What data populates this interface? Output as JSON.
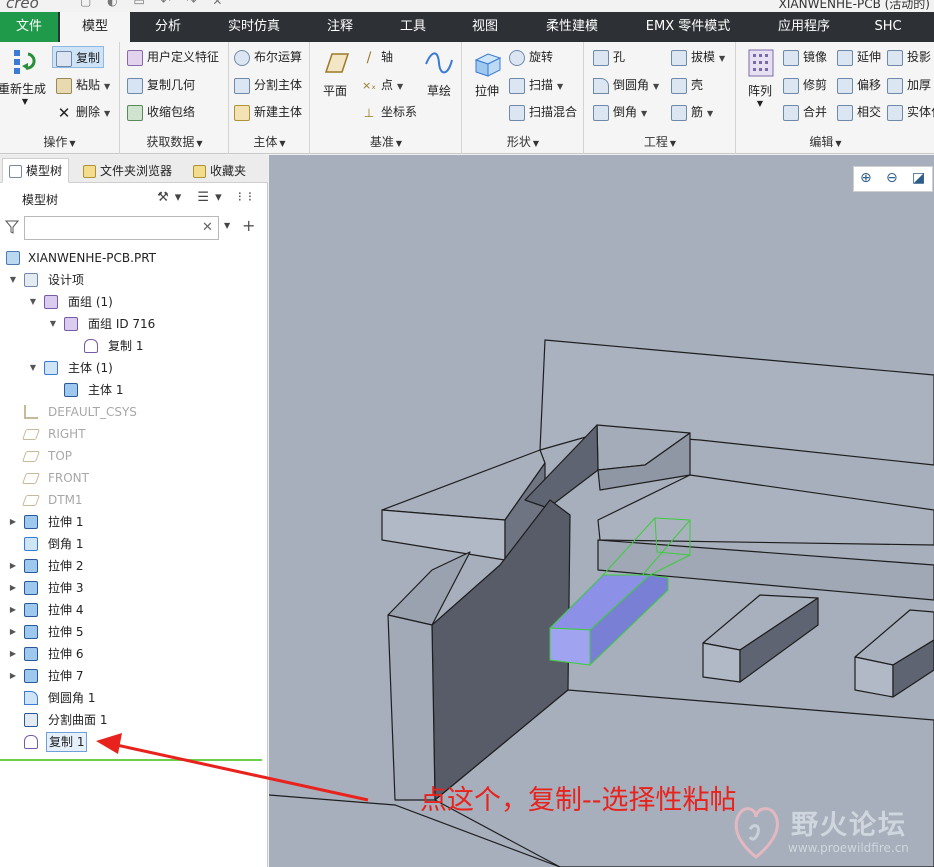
{
  "window": {
    "app_logo": "creo",
    "quick_access_icons": [
      "new-icon",
      "open-icon",
      "save-icon",
      "undo-icon",
      "redo-icon",
      "close-icon"
    ],
    "title": "XIANWENHE-PCB (活动的)"
  },
  "menu_tabs": [
    {
      "label": "文件"
    },
    {
      "label": "模型"
    },
    {
      "label": "分析"
    },
    {
      "label": "实时仿真"
    },
    {
      "label": "注释"
    },
    {
      "label": "工具"
    },
    {
      "label": "视图"
    },
    {
      "label": "柔性建模"
    },
    {
      "label": "EMX 零件模式"
    },
    {
      "label": "应用程序"
    },
    {
      "label": "SHC"
    }
  ],
  "ribbon": {
    "operations": {
      "label": "操作",
      "regenerate": "重新生成",
      "copy": "复制",
      "paste": "粘贴",
      "delete": "删除"
    },
    "get_data": {
      "label": "获取数据",
      "udf": "用户定义特征",
      "copy_geom": "复制几何",
      "shrinkwrap": "收缩包络"
    },
    "body": {
      "label": "主体",
      "boolean": "布尔运算",
      "split": "分割主体",
      "new": "新建主体"
    },
    "datum": {
      "label": "基准",
      "plane": "平面",
      "axis": "轴",
      "point": "点",
      "csys": "坐标系",
      "sketch": "草绘"
    },
    "shapes": {
      "label": "形状",
      "extrude": "拉伸",
      "revolve": "旋转",
      "sweep": "扫描",
      "swept_blend": "扫描混合"
    },
    "engineering": {
      "label": "工程",
      "hole": "孔",
      "round": "倒圆角",
      "chamfer": "倒角",
      "draft": "拔模",
      "shell": "壳",
      "rib": "筋"
    },
    "editing": {
      "label": "编辑",
      "pattern": "阵列",
      "mirror": "镜像",
      "trim": "修剪",
      "merge": "合并",
      "extend": "延伸",
      "offset": "偏移",
      "intersect": "相交",
      "project": "投影",
      "thicken": "加厚",
      "solidify": "实体化"
    }
  },
  "panel_tabs": [
    "模型树",
    "文件夹浏览器",
    "收藏夹"
  ],
  "model_tree": {
    "header": "模型树",
    "filter_placeholder": "",
    "items": [
      {
        "label": "XIANWENHE-PCB.PRT"
      },
      {
        "label": "设计项"
      },
      {
        "label": "面组 (1)"
      },
      {
        "label": "面组 ID 716"
      },
      {
        "label": "复制 1"
      },
      {
        "label": "主体 (1)"
      },
      {
        "label": "主体 1"
      },
      {
        "label": "DEFAULT_CSYS"
      },
      {
        "label": "RIGHT"
      },
      {
        "label": "TOP"
      },
      {
        "label": "FRONT"
      },
      {
        "label": "DTM1"
      },
      {
        "label": "拉伸 1"
      },
      {
        "label": "倒角 1"
      },
      {
        "label": "拉伸 2"
      },
      {
        "label": "拉伸 3"
      },
      {
        "label": "拉伸 4"
      },
      {
        "label": "拉伸 5"
      },
      {
        "label": "拉伸 6"
      },
      {
        "label": "拉伸 7"
      },
      {
        "label": "倒圆角 1"
      },
      {
        "label": "分割曲面 1"
      },
      {
        "label": "复制 1"
      }
    ]
  },
  "annotation": "点这个，复制--选择性粘帖",
  "watermark": {
    "text": "野火论坛",
    "url": "www.proewildfire.cn"
  },
  "colors": {
    "accent_green": "#1f9a4a",
    "menu_bg": "#2d3135",
    "viewport_bg": "#a7afbd",
    "annotation_red": "#e8231d",
    "selection_blue": "#8c90e6",
    "highlight_green": "#3dcc3d"
  }
}
